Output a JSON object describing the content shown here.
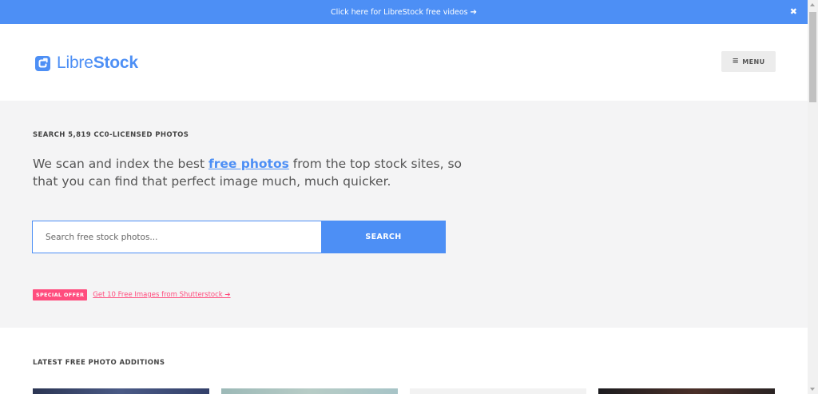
{
  "banner": {
    "text": "Click here for LibreStock free videos",
    "arrow": "➔",
    "close": "✖",
    "close_icon": "close-icon",
    "arrow_icon": "arrow-right-icon"
  },
  "header": {
    "logo_light": "Libre",
    "logo_bold": "Stock",
    "logo_icon": "librestock-logo-icon",
    "menu_icon_glyph": "≡",
    "menu_label": "MENU"
  },
  "hero": {
    "eyebrow": "SEARCH 5,819 CC0-LICENSED PHOTOS",
    "lede_before": "We scan and index the best ",
    "lede_link": "free photos",
    "lede_after": " from the top stock sites, so that you can find that perfect image much, much quicker.",
    "search_placeholder": "Search free stock photos...",
    "search_value": "",
    "search_button": "SEARCH",
    "offer_badge": "SPECIAL OFFER",
    "offer_link": "Get 10 Free Images from Shutterstock ➔"
  },
  "latest": {
    "title": "LATEST FREE PHOTO ADDITIONS"
  },
  "colors": {
    "accent": "#4d8ff5",
    "offer": "#ff4d7e",
    "hero_bg": "#f4f4f5"
  }
}
